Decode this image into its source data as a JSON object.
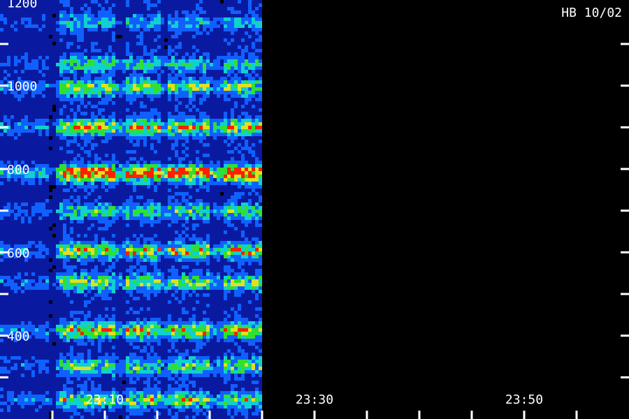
{
  "chart_data": {
    "type": "heatmap",
    "station_label": "HB 10/02",
    "y_ticks": [
      400,
      600,
      800,
      1000,
      1200
    ],
    "y_tick_labels": [
      "400",
      "600",
      "800",
      "1000",
      "1200"
    ],
    "ylim": [
      200,
      1200
    ],
    "x_tick_labels": [
      "23:10",
      "23:30",
      "23:50"
    ],
    "x_tick_minutes": [
      10,
      30,
      50
    ],
    "xlim_minutes": [
      0,
      60
    ],
    "data_end_minute": 25,
    "colormap": [
      "#000000",
      "#0a1aa0",
      "#1060ff",
      "#10d0d0",
      "#30e030",
      "#e0e020",
      "#ff2000"
    ],
    "bands": [
      {
        "center": 1150,
        "intensity": 0.25
      },
      {
        "center": 1050,
        "intensity": 0.35
      },
      {
        "center": 995,
        "intensity": 0.5
      },
      {
        "center": 900,
        "intensity": 0.6
      },
      {
        "center": 790,
        "intensity": 0.9
      },
      {
        "center": 700,
        "intensity": 0.4
      },
      {
        "center": 605,
        "intensity": 0.55
      },
      {
        "center": 530,
        "intensity": 0.5
      },
      {
        "center": 415,
        "intensity": 0.6
      },
      {
        "center": 330,
        "intensity": 0.45
      },
      {
        "center": 250,
        "intensity": 0.5
      }
    ]
  }
}
